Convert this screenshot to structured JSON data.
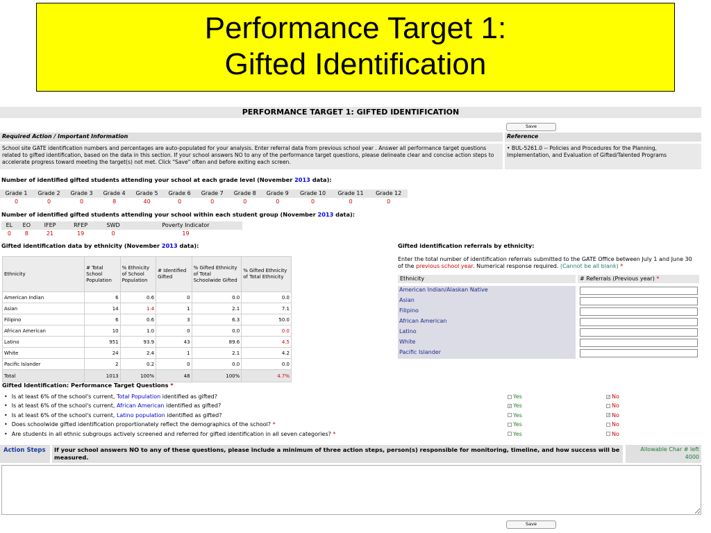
{
  "slide": {
    "title_line1": "Performance Target 1:",
    "title_line2": "Gifted Identification"
  },
  "page": {
    "header": "PERFORMANCE TARGET 1: GIFTED IDENTIFICATION",
    "save_label": "Save",
    "required_action_heading": "Required Action / Important Information",
    "reference_heading": "Reference",
    "instructions": "School site GATE identification numbers and percentages are auto-populated for your analysis. Enter referral data from previous school year . Answer all performance target questions related to gifted identification, based on the data in this section. If your school answers NO to any of the performance target questions, please delineate clear and concise action steps to accelerate progress toward meeting the target(s) not met. Click \"Save\" often and before exiting each screen.",
    "reference_text": "• BUL-5261.0 -- Policies and Procedures for the Planning, Implementation, and Evaluation of Gifted/Talented Programs",
    "year": "2013"
  },
  "grade_section": {
    "label_pre": "Number of identified gifted students attending your school at each grade level (November",
    "label_post": "data):",
    "headers": [
      "Grade 1",
      "Grade 2",
      "Grade 3",
      "Grade 4",
      "Grade 5",
      "Grade 6",
      "Grade 7",
      "Grade 8",
      "Grade 9",
      "Grade 10",
      "Grade 11",
      "Grade 12"
    ],
    "values": [
      "0",
      "0",
      "0",
      "8",
      "40",
      "0",
      "0",
      "0",
      "0",
      "0",
      "0",
      "0"
    ]
  },
  "group_section": {
    "label_pre": "Number of identified gifted students attending your school within each student group (November",
    "label_post": "data):",
    "headers": [
      "EL",
      "EO",
      "IFEP",
      "RFEP",
      "SWD",
      "Poverty Indicator"
    ],
    "values": [
      "0",
      "8",
      "21",
      "19",
      "0",
      "19"
    ]
  },
  "ethnicity_section": {
    "label_pre": "Gifted identification data by ethnicity (November",
    "label_post": "data):",
    "headers": [
      "Ethnicity",
      "# Total School Population",
      "% Ethnicity of School Population",
      "# Identified Gifted",
      "% Gifted Ethnicity of Total Schoolwide Gifted",
      "% Gifted Ethnicity of Total Ethnicity"
    ],
    "rows": [
      [
        "American Indian",
        "6",
        "0.6",
        "0",
        "0.0",
        "0.0"
      ],
      [
        "Asian",
        "14",
        "1.4",
        "1",
        "2.1",
        "7.1"
      ],
      [
        "Filipino",
        "6",
        "0.6",
        "3",
        "6.3",
        "50.0"
      ],
      [
        "African American",
        "10",
        "1.0",
        "0",
        "0.0",
        "0.0"
      ],
      [
        "Latino",
        "951",
        "93.9",
        "43",
        "89.6",
        "4.5"
      ],
      [
        "White",
        "24",
        "2.4",
        "1",
        "2.1",
        "4.2"
      ],
      [
        "Pacific Islander",
        "2",
        "0.2",
        "0",
        "0.0",
        "0.0"
      ]
    ],
    "total": [
      "Total",
      "1013",
      "100%",
      "48",
      "100%",
      "4.7%"
    ]
  },
  "referrals": {
    "heading": "Gifted identification referrals by ethnicity:",
    "desc_a": "Enter the total number of identification referrals submitted to the GATE Office between July 1 and June 30 of the",
    "desc_link": "previous school year",
    "desc_b": ". Numerical response required.",
    "desc_note": "(Cannot be all blank)",
    "req_mark": "*",
    "col1": "Ethnicity",
    "col2": "# Referrals (Previous year)",
    "rows": [
      "American Indian/Alaskan Native",
      "Asian",
      "Filipino",
      "African American",
      "Latino",
      "White",
      "Pacific Islander"
    ]
  },
  "questions": {
    "heading": "Gifted Identification: Performance Target Questions",
    "req_mark": "*",
    "yes_label": "Yes",
    "no_label": "No",
    "items": [
      {
        "pre": "Is at least 6% of the school's current,",
        "link": "Total Population",
        "post": "identified as gifted?",
        "req": "",
        "yes": "",
        "no": "✓"
      },
      {
        "pre": "Is at least 6% of the school's current,",
        "link": "African American",
        "post": "identified as gifted?",
        "req": "",
        "yes": "✓",
        "no": ""
      },
      {
        "pre": "Is at least 6% of the school's current,",
        "link": "Latino population",
        "post": "identified as gifted?",
        "req": "",
        "yes": "",
        "no": "✓"
      },
      {
        "pre": "Does schoolwide gifted identification proportionately reflect the demographics of the school?",
        "link": "",
        "post": "",
        "req": "*",
        "yes": "",
        "no": ""
      },
      {
        "pre": "Are students in all ethnic subgroups actively screened and referred for gifted identification in all seven categories?",
        "link": "",
        "post": "",
        "req": "*",
        "yes": "",
        "no": ""
      }
    ]
  },
  "action_steps": {
    "label": "Action Steps",
    "instruction": "If your school answers NO to any of these questions, please include a minimum of three action steps, person(s) responsible for monitoring, timeline, and how success will be measured.",
    "allowable_label": "Allowable Char # left",
    "allowable_value": "4000"
  },
  "colors": {
    "title_bg": "#ffff00",
    "link_blue": "#0000ee",
    "required_red": "#cc0000",
    "yes_green": "#2a7a2a"
  }
}
